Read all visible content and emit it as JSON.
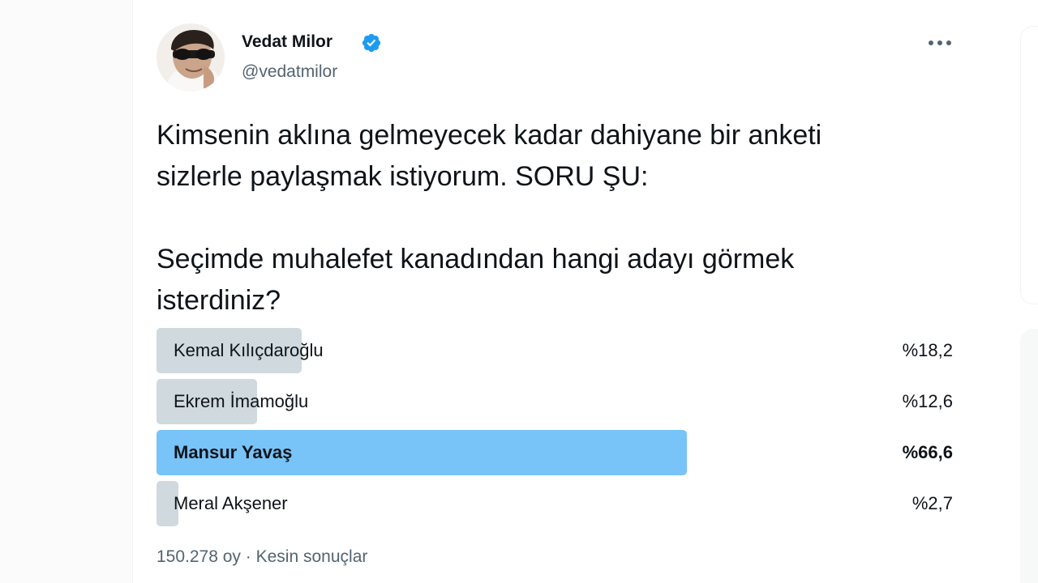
{
  "author": {
    "name": "Vedat Milor",
    "handle": "@vedatmilor",
    "verified": true
  },
  "tweet": {
    "text": "Kimsenin aklına gelmeyecek kadar dahiyane bir anketi\nsizlerle paylaşmak istiyorum. SORU ŞU:\n\nSeçimde muhalefet kanadından hangi adayı görmek\nisterdiniz?"
  },
  "poll": {
    "options": [
      {
        "label": "Kemal Kılıçdaroğlu",
        "percent_text": "%18,2",
        "percent": 18.2,
        "winner": false
      },
      {
        "label": "Ekrem İmamoğlu",
        "percent_text": "%12,6",
        "percent": 12.6,
        "winner": false
      },
      {
        "label": "Mansur Yavaş",
        "percent_text": "%66,6",
        "percent": 66.6,
        "winner": true
      },
      {
        "label": "Meral Akşener",
        "percent_text": "%2,7",
        "percent": 2.7,
        "winner": false
      }
    ],
    "votes": "150.278 oy",
    "separator": "·",
    "status": "Kesin sonuçlar"
  },
  "colors": {
    "accent": "#1d9bf0",
    "winner_bar": "#78c3f7",
    "bar": "#cfd9de",
    "secondary_text": "#536471"
  },
  "icons": {
    "verified": "verified-badge-icon",
    "more": "more-horizontal-icon"
  }
}
